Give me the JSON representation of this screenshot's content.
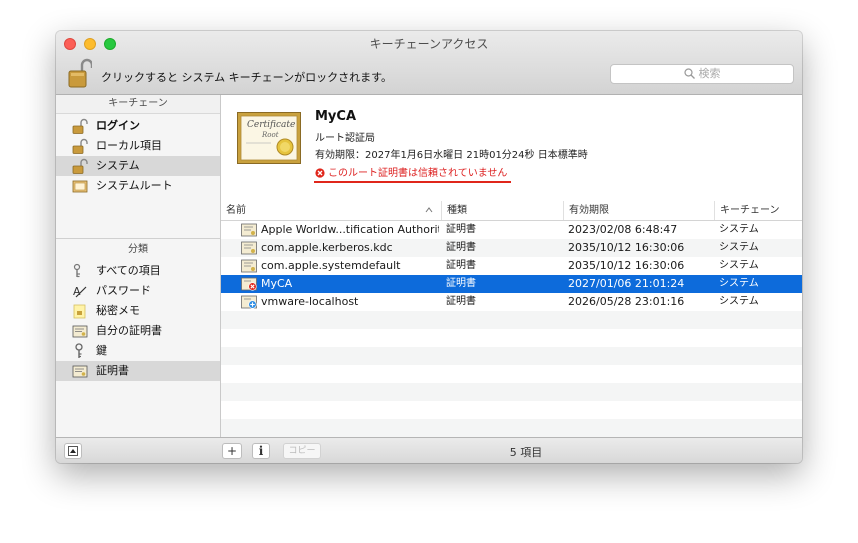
{
  "window": {
    "title": "キーチェーンアクセス",
    "lock_message": "クリックすると システム キーチェーンがロックされます。",
    "search_placeholder": "検索"
  },
  "sidebar": {
    "keychains_header": "キーチェーン",
    "keychains": [
      {
        "label": "ログイン",
        "icon": "lock-open-icon",
        "bold": true
      },
      {
        "label": "ローカル項目",
        "icon": "lock-open-icon"
      },
      {
        "label": "システム",
        "icon": "lock-open-icon",
        "selected": true
      },
      {
        "label": "システムルート",
        "icon": "cabinet-icon"
      }
    ],
    "categories_header": "分類",
    "categories": [
      {
        "label": "すべての項目",
        "icon": "all-items-icon"
      },
      {
        "label": "パスワード",
        "icon": "password-icon"
      },
      {
        "label": "秘密メモ",
        "icon": "secure-note-icon"
      },
      {
        "label": "自分の証明書",
        "icon": "my-certificate-icon"
      },
      {
        "label": "鍵",
        "icon": "key-icon"
      },
      {
        "label": "証明書",
        "icon": "certificate-icon",
        "selected": true
      }
    ]
  },
  "detail": {
    "name": "MyCA",
    "kind": "ルート認証局",
    "expiry": "有効期限：2027年1月6日水曜日 21時01分24秒 日本標準時",
    "warning": "このルート証明書は信頼されていません",
    "warning_color": "#d22222"
  },
  "table": {
    "columns": [
      "名前",
      "種類",
      "有効期限",
      "キーチェーン"
    ],
    "rows": [
      {
        "name": "Apple Worldw...tification Authority",
        "kind": "証明書",
        "expires": "2023/02/08 6:48:47",
        "keychain": "システム",
        "icon": "certificate-icon"
      },
      {
        "name": "com.apple.kerberos.kdc",
        "kind": "証明書",
        "expires": "2035/10/12 16:30:06",
        "keychain": "システム",
        "icon": "certificate-icon"
      },
      {
        "name": "com.apple.systemdefault",
        "kind": "証明書",
        "expires": "2035/10/12 16:30:06",
        "keychain": "システム",
        "icon": "certificate-icon"
      },
      {
        "name": "MyCA",
        "kind": "証明書",
        "expires": "2027/01/06 21:01:24",
        "keychain": "システム",
        "icon": "untrusted-certificate-icon",
        "selected": true
      },
      {
        "name": "vmware-localhost",
        "kind": "証明書",
        "expires": "2026/05/28 23:01:16",
        "keychain": "システム",
        "icon": "custom-trust-certificate-icon"
      }
    ]
  },
  "bottom": {
    "add_label": "+",
    "info_label": "i",
    "copy_label": "コピー",
    "count": "5 項目"
  },
  "colors": {
    "selection": "#0d6bdb",
    "sidebar_selection": "#d8d8d8"
  }
}
